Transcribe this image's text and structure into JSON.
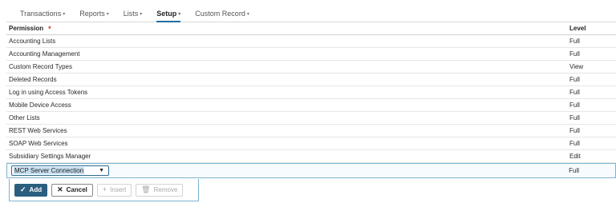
{
  "tabs": [
    {
      "label": "Transactions",
      "active": false
    },
    {
      "label": "Reports",
      "active": false
    },
    {
      "label": "Lists",
      "active": false
    },
    {
      "label": "Setup",
      "active": true
    },
    {
      "label": "Custom Record",
      "active": false
    }
  ],
  "table": {
    "headers": {
      "permission": "Permission",
      "required_mark": "*",
      "level": "Level"
    },
    "rows": [
      {
        "permission": "Accounting Lists",
        "level": "Full"
      },
      {
        "permission": "Accounting Management",
        "level": "Full"
      },
      {
        "permission": "Custom Record Types",
        "level": "View"
      },
      {
        "permission": "Deleted Records",
        "level": "Full"
      },
      {
        "permission": "Log in using Access Tokens",
        "level": "Full"
      },
      {
        "permission": "Mobile Device Access",
        "level": "Full"
      },
      {
        "permission": "Other Lists",
        "level": "Full"
      },
      {
        "permission": "REST Web Services",
        "level": "Full"
      },
      {
        "permission": "SOAP Web Services",
        "level": "Full"
      },
      {
        "permission": "Subsidiary Settings Manager",
        "level": "Edit"
      }
    ],
    "edit_row": {
      "permission_value": "MCP Server Connection",
      "level": "Full"
    }
  },
  "actions": {
    "add": "Add",
    "cancel": "Cancel",
    "insert": "Insert",
    "remove": "Remove"
  },
  "colors": {
    "accent": "#2b5e7e",
    "edit_border": "#7fb3d1",
    "required": "#c0392b"
  }
}
